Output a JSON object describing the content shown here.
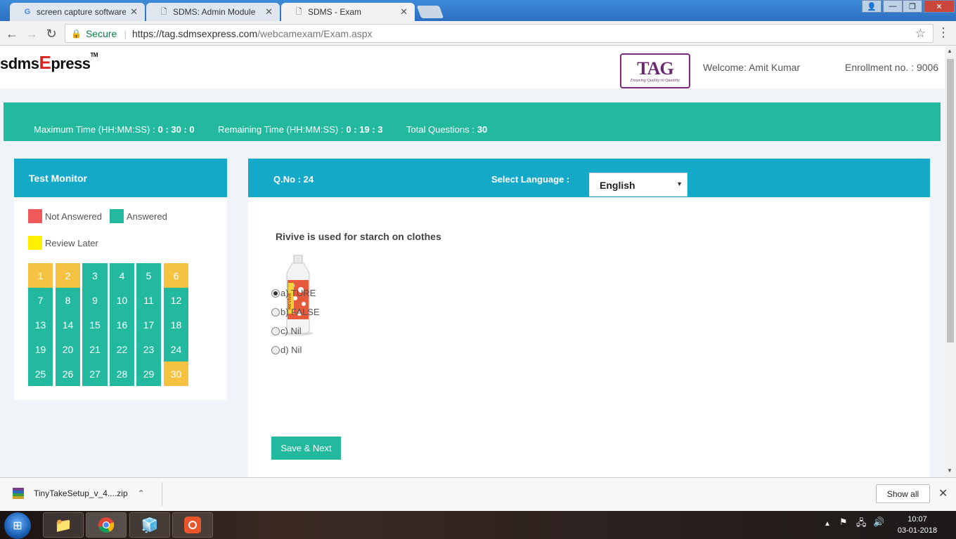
{
  "browser": {
    "tabs": [
      {
        "label": "screen capture software",
        "icon": "google-icon",
        "active": false
      },
      {
        "label": "SDMS: Admin Module",
        "icon": "page-icon",
        "active": false
      },
      {
        "label": "SDMS - Exam",
        "icon": "page-icon",
        "active": true
      }
    ],
    "secure_label": "Secure",
    "url_host": "https://tag.sdmsexpress.com",
    "url_path": "/webcamexam/Exam.aspx"
  },
  "header": {
    "logo_prefix": "sdms",
    "logo_x": "E",
    "logo_x2": "x",
    "logo_suffix": "press",
    "logo_tm": "TM",
    "partner_logo_text": "TAG",
    "partner_logo_tagline": "Ensuring Quality in Quantity",
    "welcome": "Welcome: Amit Kumar",
    "enrollment": "Enrollment no. : 9006"
  },
  "timebar": {
    "max_time_label": "Maximum Time (HH:MM:SS) :",
    "max_time_value": "0 : 30 : 0",
    "remaining_label": "Remaining Time (HH:MM:SS) :",
    "remaining_value": "0 : 19 : 3",
    "total_label": "Total Questions :",
    "total_value": "30"
  },
  "monitor": {
    "title": "Test Monitor",
    "legend": {
      "not_answered": "Not Answered",
      "answered": "Answered",
      "review_later": "Review Later"
    },
    "colors": {
      "not_answered": "#f05a5a",
      "answered": "#23b99f",
      "review_later": "#f5c242",
      "review_legend": "#ffef00"
    },
    "questions": [
      {
        "n": "1",
        "status": "review"
      },
      {
        "n": "2",
        "status": "review"
      },
      {
        "n": "3",
        "status": "answered"
      },
      {
        "n": "4",
        "status": "answered"
      },
      {
        "n": "5",
        "status": "answered"
      },
      {
        "n": "6",
        "status": "review"
      },
      {
        "n": "7",
        "status": "answered"
      },
      {
        "n": "8",
        "status": "answered"
      },
      {
        "n": "9",
        "status": "answered"
      },
      {
        "n": "10",
        "status": "answered"
      },
      {
        "n": "11",
        "status": "answered"
      },
      {
        "n": "12",
        "status": "answered"
      },
      {
        "n": "13",
        "status": "answered"
      },
      {
        "n": "14",
        "status": "answered"
      },
      {
        "n": "15",
        "status": "answered"
      },
      {
        "n": "16",
        "status": "answered"
      },
      {
        "n": "17",
        "status": "answered"
      },
      {
        "n": "18",
        "status": "answered"
      },
      {
        "n": "19",
        "status": "answered"
      },
      {
        "n": "20",
        "status": "answered"
      },
      {
        "n": "21",
        "status": "answered"
      },
      {
        "n": "22",
        "status": "answered"
      },
      {
        "n": "23",
        "status": "answered"
      },
      {
        "n": "24",
        "status": "answered"
      },
      {
        "n": "25",
        "status": "answered"
      },
      {
        "n": "26",
        "status": "answered"
      },
      {
        "n": "27",
        "status": "answered"
      },
      {
        "n": "28",
        "status": "answered"
      },
      {
        "n": "29",
        "status": "answered"
      },
      {
        "n": "30",
        "status": "review"
      }
    ]
  },
  "question": {
    "number_label": "Q.No : 24",
    "language_label": "Select Language :",
    "language_value": "English",
    "text": "Rivive is used for starch on clothes",
    "image_label": "ReVive",
    "options": [
      {
        "label": "a) TURE",
        "checked": true
      },
      {
        "label": "b) FALSE",
        "checked": false
      },
      {
        "label": "c) Nil",
        "checked": false
      },
      {
        "label": "d) Nil",
        "checked": false
      }
    ],
    "save_label": "Save & Next"
  },
  "downloads": {
    "file": "TinyTakeSetup_v_4....zip",
    "show_all": "Show all"
  },
  "taskbar": {
    "time": "10:07",
    "date": "03-01-2018"
  }
}
